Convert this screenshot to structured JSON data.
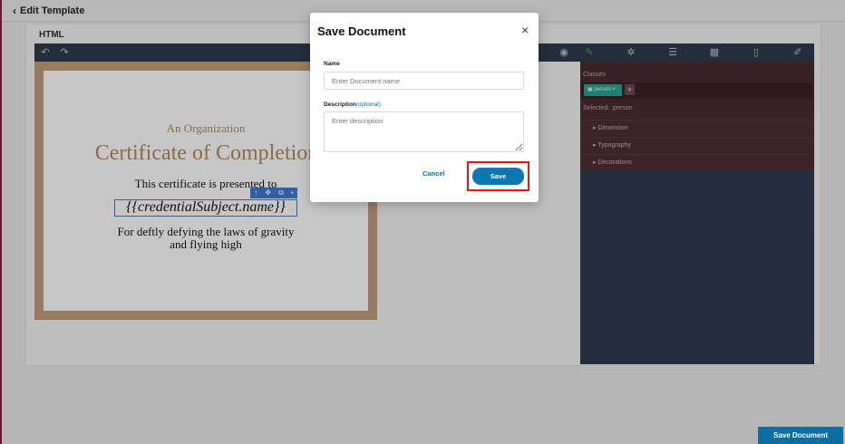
{
  "header": {
    "back_label": "Edit Template"
  },
  "editor": {
    "panel_title": "HTML",
    "certificate": {
      "organization": "An Organization",
      "title": "Certificate of Completion",
      "presented": "This certificate is presented to",
      "subject": "{{credentialSubject.name}}",
      "body_line1": "For deftly defying the laws of gravity",
      "body_line2": "and flying high"
    },
    "style_panel": {
      "classes_label": "Classes",
      "class_tag": "person",
      "add_label": "+",
      "selected_prefix": "Selected:",
      "selected_value": ".person",
      "sectors": [
        "Dimension",
        "Typography",
        "Decorations"
      ]
    }
  },
  "modal": {
    "title": "Save Document",
    "close_symbol": "×",
    "name_label": "Name",
    "name_placeholder": "Enter Document name",
    "description_label": "Description",
    "optional_label": "(optional)",
    "description_placeholder": "Enter description",
    "cancel_label": "Cancel",
    "save_label": "Save"
  },
  "footer": {
    "save_document_label": "Save Document"
  },
  "icons": {
    "undo": "undo-icon",
    "redo": "redo-icon",
    "preview": "eye-icon",
    "style_manager": "brush-icon",
    "settings": "gear-icon",
    "layers": "layers-icon",
    "blocks": "blocks-icon",
    "code": "code-icon",
    "edit": "edit-icon"
  },
  "colors": {
    "accent": "#0a78b5",
    "highlight": "#e01818",
    "cert_gold": "#b08a5f"
  }
}
